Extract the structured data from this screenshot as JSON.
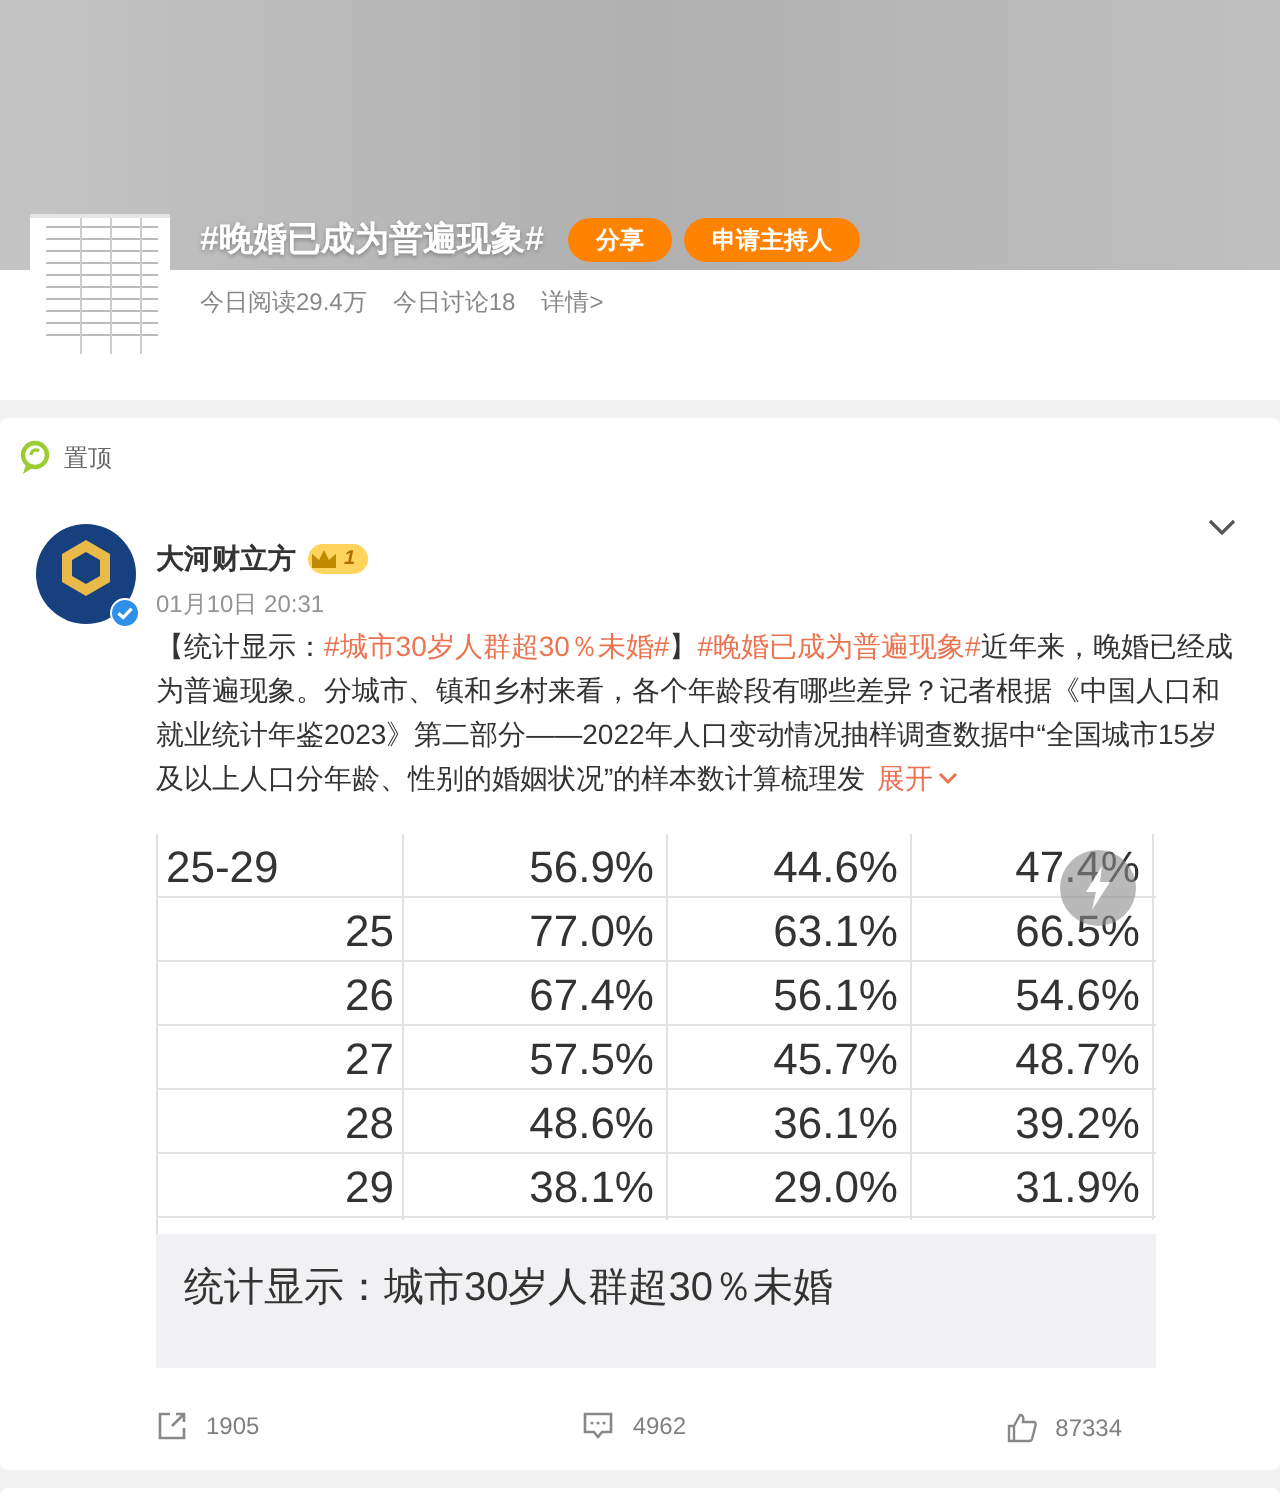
{
  "topic": {
    "title": "#晚婚已成为普遍现象#",
    "buttons": [
      "分享",
      "申请主持人"
    ],
    "stats": [
      "今日阅读29.4万",
      "今日讨论18",
      "详情>"
    ]
  },
  "pinned_label": "置顶",
  "post": {
    "author": "大河财立方",
    "vip_level": "1",
    "verified": true,
    "time": "01月10日 20:31",
    "body": [
      {
        "kind": "plain",
        "text": "【统计显示："
      },
      {
        "kind": "hashtag",
        "text": "#城市30岁人群超30％未婚#"
      },
      {
        "kind": "plain",
        "text": "】"
      },
      {
        "kind": "hashtag",
        "text": "#晚婚已成为普遍现象#"
      },
      {
        "kind": "plain",
        "text": "近年来，晚婚已经成为普遍现象。分城市、镇和乡村来看，各个年龄段有哪些差异？记者根据《中国人口和就业统计年鉴2023》第二部分——2022年人口变动情况抽样调查数据中“全国城市15岁及以上人口分年龄、性别的婚姻状况”的样本数计算梳理发"
      }
    ],
    "expand": "展开",
    "image_table": [
      {
        "kind": "group",
        "cells": [
          "25-29",
          "56.9%",
          "44.6%",
          "47.4%"
        ]
      },
      {
        "kind": "age",
        "cells": [
          "25",
          "77.0%",
          "63.1%",
          "66.5%"
        ]
      },
      {
        "kind": "age",
        "cells": [
          "26",
          "67.4%",
          "56.1%",
          "54.6%"
        ]
      },
      {
        "kind": "age",
        "cells": [
          "27",
          "57.5%",
          "45.7%",
          "48.7%"
        ]
      },
      {
        "kind": "age",
        "cells": [
          "28",
          "48.6%",
          "36.1%",
          "39.2%"
        ]
      },
      {
        "kind": "age",
        "cells": [
          "29",
          "38.1%",
          "29.0%",
          "31.9%"
        ]
      }
    ],
    "image_caption": "统计显示：城市30岁人群超30％未婚",
    "actions": [
      {
        "kind": "share",
        "count": "1905"
      },
      {
        "kind": "comment",
        "count": "4962"
      },
      {
        "kind": "like",
        "count": "87334"
      }
    ]
  }
}
